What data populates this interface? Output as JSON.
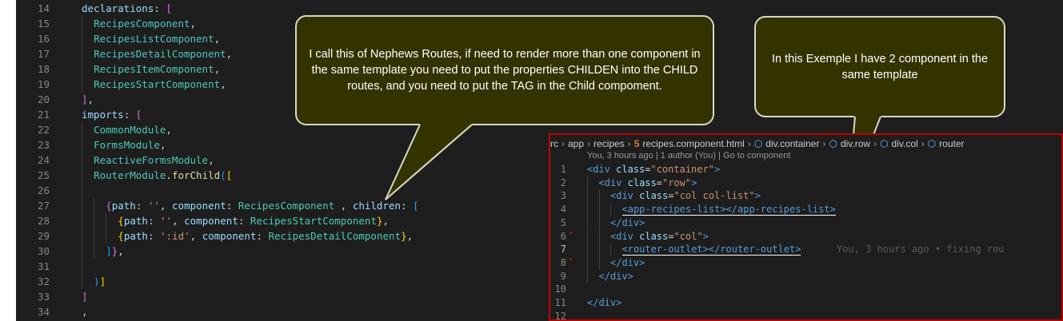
{
  "editor": {
    "lines": [
      {
        "n": "14",
        "indent": 1,
        "parts": [
          {
            "t": "declarations",
            "c": "kw"
          },
          {
            "t": ": ",
            "c": "pl"
          },
          {
            "t": "[",
            "c": "br2"
          }
        ]
      },
      {
        "n": "15",
        "indent": 2,
        "parts": [
          {
            "t": "RecipesComponent",
            "c": "cls"
          },
          {
            "t": ",",
            "c": "pl"
          }
        ]
      },
      {
        "n": "16",
        "indent": 2,
        "parts": [
          {
            "t": "RecipesListComponent",
            "c": "cls"
          },
          {
            "t": ",",
            "c": "pl"
          }
        ]
      },
      {
        "n": "17",
        "indent": 2,
        "parts": [
          {
            "t": "RecipesDetailComponent",
            "c": "cls"
          },
          {
            "t": ",",
            "c": "pl"
          }
        ]
      },
      {
        "n": "18",
        "indent": 2,
        "parts": [
          {
            "t": "RecipesItemComponent",
            "c": "cls"
          },
          {
            "t": ",",
            "c": "pl"
          }
        ]
      },
      {
        "n": "19",
        "indent": 2,
        "parts": [
          {
            "t": "RecipesStartComponent",
            "c": "cls"
          },
          {
            "t": ",",
            "c": "pl"
          }
        ]
      },
      {
        "n": "20",
        "indent": 1,
        "parts": [
          {
            "t": "]",
            "c": "br2"
          },
          {
            "t": ",",
            "c": "pl"
          }
        ]
      },
      {
        "n": "21",
        "indent": 1,
        "parts": [
          {
            "t": "imports",
            "c": "kw"
          },
          {
            "t": ": ",
            "c": "pl"
          },
          {
            "t": "[",
            "c": "br2"
          }
        ]
      },
      {
        "n": "22",
        "indent": 2,
        "parts": [
          {
            "t": "CommonModule",
            "c": "cls"
          },
          {
            "t": ",",
            "c": "pl"
          }
        ]
      },
      {
        "n": "23",
        "indent": 2,
        "parts": [
          {
            "t": "FormsModule",
            "c": "cls"
          },
          {
            "t": ",",
            "c": "pl"
          }
        ]
      },
      {
        "n": "24",
        "indent": 2,
        "parts": [
          {
            "t": "ReactiveFormsModule",
            "c": "cls"
          },
          {
            "t": ",",
            "c": "pl"
          }
        ]
      },
      {
        "n": "25",
        "indent": 2,
        "parts": [
          {
            "t": "RouterModule",
            "c": "cls"
          },
          {
            "t": ".",
            "c": "pl"
          },
          {
            "t": "forChild",
            "c": "fn"
          },
          {
            "t": "(",
            "c": "br3"
          },
          {
            "t": "[",
            "c": "br"
          }
        ]
      },
      {
        "n": "26",
        "indent": 2,
        "parts": []
      },
      {
        "n": "27",
        "indent": 3,
        "parts": [
          {
            "t": "{",
            "c": "br2"
          },
          {
            "t": "path",
            "c": "kw"
          },
          {
            "t": ": ",
            "c": "pl"
          },
          {
            "t": "''",
            "c": "str"
          },
          {
            "t": ", ",
            "c": "pl"
          },
          {
            "t": "component",
            "c": "kw"
          },
          {
            "t": ": ",
            "c": "pl"
          },
          {
            "t": "RecipesComponent",
            "c": "cls"
          },
          {
            "t": " , ",
            "c": "pl"
          },
          {
            "t": "children",
            "c": "kw"
          },
          {
            "t": ": ",
            "c": "pl"
          },
          {
            "t": "[",
            "c": "br3"
          }
        ]
      },
      {
        "n": "28",
        "indent": 4,
        "parts": [
          {
            "t": "{",
            "c": "br"
          },
          {
            "t": "path",
            "c": "kw"
          },
          {
            "t": ": ",
            "c": "pl"
          },
          {
            "t": "''",
            "c": "str"
          },
          {
            "t": ", ",
            "c": "pl"
          },
          {
            "t": "component",
            "c": "kw"
          },
          {
            "t": ": ",
            "c": "pl"
          },
          {
            "t": "RecipesStartComponent",
            "c": "cls"
          },
          {
            "t": "}",
            "c": "br"
          },
          {
            "t": ",",
            "c": "pl"
          }
        ]
      },
      {
        "n": "29",
        "indent": 4,
        "parts": [
          {
            "t": "{",
            "c": "br"
          },
          {
            "t": "path",
            "c": "kw"
          },
          {
            "t": ": ",
            "c": "pl"
          },
          {
            "t": "':id'",
            "c": "str"
          },
          {
            "t": ", ",
            "c": "pl"
          },
          {
            "t": "component",
            "c": "kw"
          },
          {
            "t": ": ",
            "c": "pl"
          },
          {
            "t": "RecipesDetailComponent",
            "c": "cls"
          },
          {
            "t": "}",
            "c": "br"
          },
          {
            "t": ",",
            "c": "pl"
          }
        ]
      },
      {
        "n": "30",
        "indent": 3,
        "parts": [
          {
            "t": "]",
            "c": "br3"
          },
          {
            "t": "}",
            "c": "br2"
          },
          {
            "t": ",",
            "c": "pl"
          }
        ]
      },
      {
        "n": "31",
        "indent": 2,
        "parts": []
      },
      {
        "n": "32",
        "indent": 2,
        "parts": [
          {
            "t": ")",
            "c": "br3"
          },
          {
            "t": "]",
            "c": "br"
          }
        ]
      },
      {
        "n": "33",
        "indent": 1,
        "parts": [
          {
            "t": "]",
            "c": "br2"
          }
        ]
      },
      {
        "n": "34",
        "indent": 1,
        "parts": [
          {
            "t": ",",
            "c": "pl"
          }
        ]
      }
    ]
  },
  "callouts": {
    "left": "I call this of Nephews Routes, if need to render more than one component in the same template you need to put the properties CHILDEN  into the CHILD routes, and you need to put the TAG in the Child compoment.",
    "right": "In this Exemple I have 2  component in the same template"
  },
  "panel": {
    "breadcrumb": [
      "rc",
      "app",
      "recipes",
      "recipes.component.html",
      "div.container",
      "div.row",
      "div.col",
      "router"
    ],
    "blame": "You, 3 hours ago | 1 author (You) | Go to component",
    "lines": [
      {
        "n": "1",
        "ind": 0,
        "parts": [
          {
            "t": "<div ",
            "c": "tag"
          },
          {
            "t": "class",
            "c": "attr"
          },
          {
            "t": "=",
            "c": "pl"
          },
          {
            "t": "\"container\"",
            "c": "aval"
          },
          {
            "t": ">",
            "c": "tag"
          }
        ]
      },
      {
        "n": "2",
        "ind": 1,
        "parts": [
          {
            "t": "<div ",
            "c": "tag"
          },
          {
            "t": "class",
            "c": "attr"
          },
          {
            "t": "=",
            "c": "pl"
          },
          {
            "t": "\"row\"",
            "c": "aval"
          },
          {
            "t": ">",
            "c": "tag"
          }
        ]
      },
      {
        "n": "3",
        "ind": 2,
        "parts": [
          {
            "t": "<div ",
            "c": "tag"
          },
          {
            "t": "class",
            "c": "attr"
          },
          {
            "t": "=",
            "c": "pl"
          },
          {
            "t": "\"col col-list\"",
            "c": "aval"
          },
          {
            "t": ">",
            "c": "tag"
          }
        ]
      },
      {
        "n": "4",
        "ind": 3,
        "under": true,
        "parts": [
          {
            "t": "<app-recipes-list></app-recipes-list>",
            "c": "tag"
          }
        ]
      },
      {
        "n": "5",
        "ind": 2,
        "parts": [
          {
            "t": "</div>",
            "c": "tag"
          }
        ]
      },
      {
        "n": "6",
        "ind": 2,
        "parts": [
          {
            "t": "<div ",
            "c": "tag"
          },
          {
            "t": "class",
            "c": "attr"
          },
          {
            "t": "=",
            "c": "pl"
          },
          {
            "t": "\"col\"",
            "c": "aval"
          },
          {
            "t": ">",
            "c": "tag"
          }
        ]
      },
      {
        "n": "7",
        "ind": 3,
        "under": true,
        "parts": [
          {
            "t": "<router-outlet></router-outlet>",
            "c": "tag"
          }
        ],
        "ghost": "You, 3 hours ago • fixing rou"
      },
      {
        "n": "8",
        "ind": 2,
        "parts": [
          {
            "t": "</div>",
            "c": "tag"
          }
        ]
      },
      {
        "n": "9",
        "ind": 1,
        "parts": [
          {
            "t": "</div>",
            "c": "tag"
          }
        ]
      },
      {
        "n": "10",
        "ind": 0,
        "parts": []
      },
      {
        "n": "11",
        "ind": 0,
        "parts": [
          {
            "t": "</div>",
            "c": "tag"
          }
        ]
      },
      {
        "n": "12",
        "ind": 0,
        "parts": []
      }
    ]
  }
}
